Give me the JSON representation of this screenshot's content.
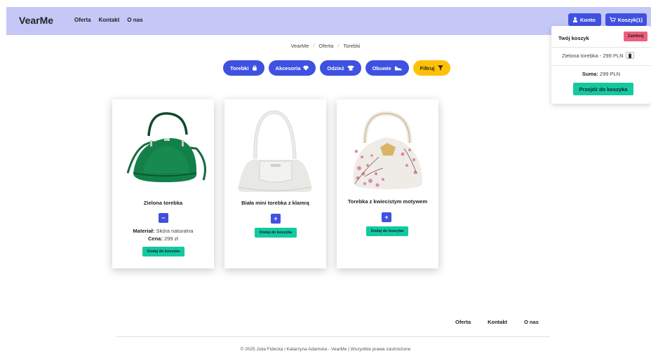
{
  "navbar": {
    "brand": "VearMe",
    "links": [
      "Oferta",
      "Kontakt",
      "O nas"
    ],
    "account_label": "Konto",
    "cart_label": "Koszyk(1)"
  },
  "cart": {
    "title": "Twój koszyk",
    "close_label": "Zamknij",
    "items": [
      {
        "label": "Zielona torebka - 299 PLN"
      }
    ],
    "sum_label": "Suma:",
    "sum_value": "299 PLN",
    "checkout_label": "Przejdź do koszyka"
  },
  "breadcrumb": [
    "VearMe",
    "Oferta",
    "Torebki"
  ],
  "categories": [
    {
      "label": "Torebki",
      "icon": "bag-icon"
    },
    {
      "label": "Akcesoria",
      "icon": "gem-icon"
    },
    {
      "label": "Odzież",
      "icon": "shirt-icon"
    },
    {
      "label": "Obuwie",
      "icon": "shoe-icon"
    },
    {
      "label": "Filtruj",
      "icon": "filter-icon"
    }
  ],
  "products": [
    {
      "name": "Zielona torebka",
      "qty_symbol": "−",
      "material_label": "Materiał:",
      "material": "Skóra naturalna",
      "price_label": "Cena:",
      "price": "299 zł",
      "add_label": "Dodaj do koszyka"
    },
    {
      "name": "Biała mini torebka z klamrą",
      "qty_symbol": "+",
      "add_label": "Dodaj do koszyka"
    },
    {
      "name": "Torebka z kwiecistym motywem",
      "qty_symbol": "+",
      "add_label": "Dodaj do koszyka"
    }
  ],
  "footer": {
    "links": [
      "Oferta",
      "Kontakt",
      "O nas"
    ],
    "copyright": "© 2025 Julia Fidecka i Katarzyna Adamska - VearMe | Wszystkie prawa zastrzeżone"
  },
  "colors": {
    "nav_bg": "#c5c8f7",
    "primary": "#3f51e0",
    "success": "#14c9a0",
    "warning": "#ffc107",
    "danger": "#ef5f7d"
  }
}
